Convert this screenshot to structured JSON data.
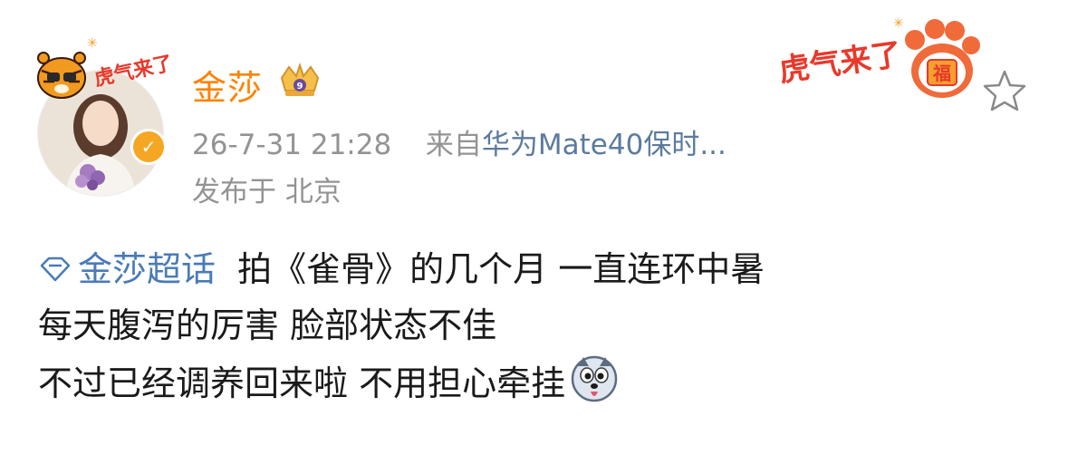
{
  "user": {
    "name": "金莎",
    "avatar_frame_text": "虎气来了"
  },
  "post": {
    "time": "26-7-31 21:28",
    "source_prefix": "来自",
    "source_device": "华为Mate40保时...",
    "location": "发布于 北京",
    "topic": "金莎超话",
    "line1_text": "拍《雀骨》的几个月 一直连环中暑",
    "line2_text": "每天腹泻的厉害 脸部状态不佳",
    "line3_text": "不过已经调养回来啦 不用担心牵挂"
  },
  "decoration": {
    "right_banner_text": "虎气来了",
    "fu_text": "福"
  },
  "icons": {
    "verified": "verified-badge-icon",
    "crown": "crown-badge-icon",
    "star": "star-outline-icon",
    "topic": "diamond-topic-icon",
    "emoji": "husky-emoji-icon"
  },
  "colors": {
    "username": "#ff8200",
    "meta": "#939393",
    "source": "#5c7b9e",
    "topic": "#4a7bb7",
    "verified": "#f5a623"
  }
}
